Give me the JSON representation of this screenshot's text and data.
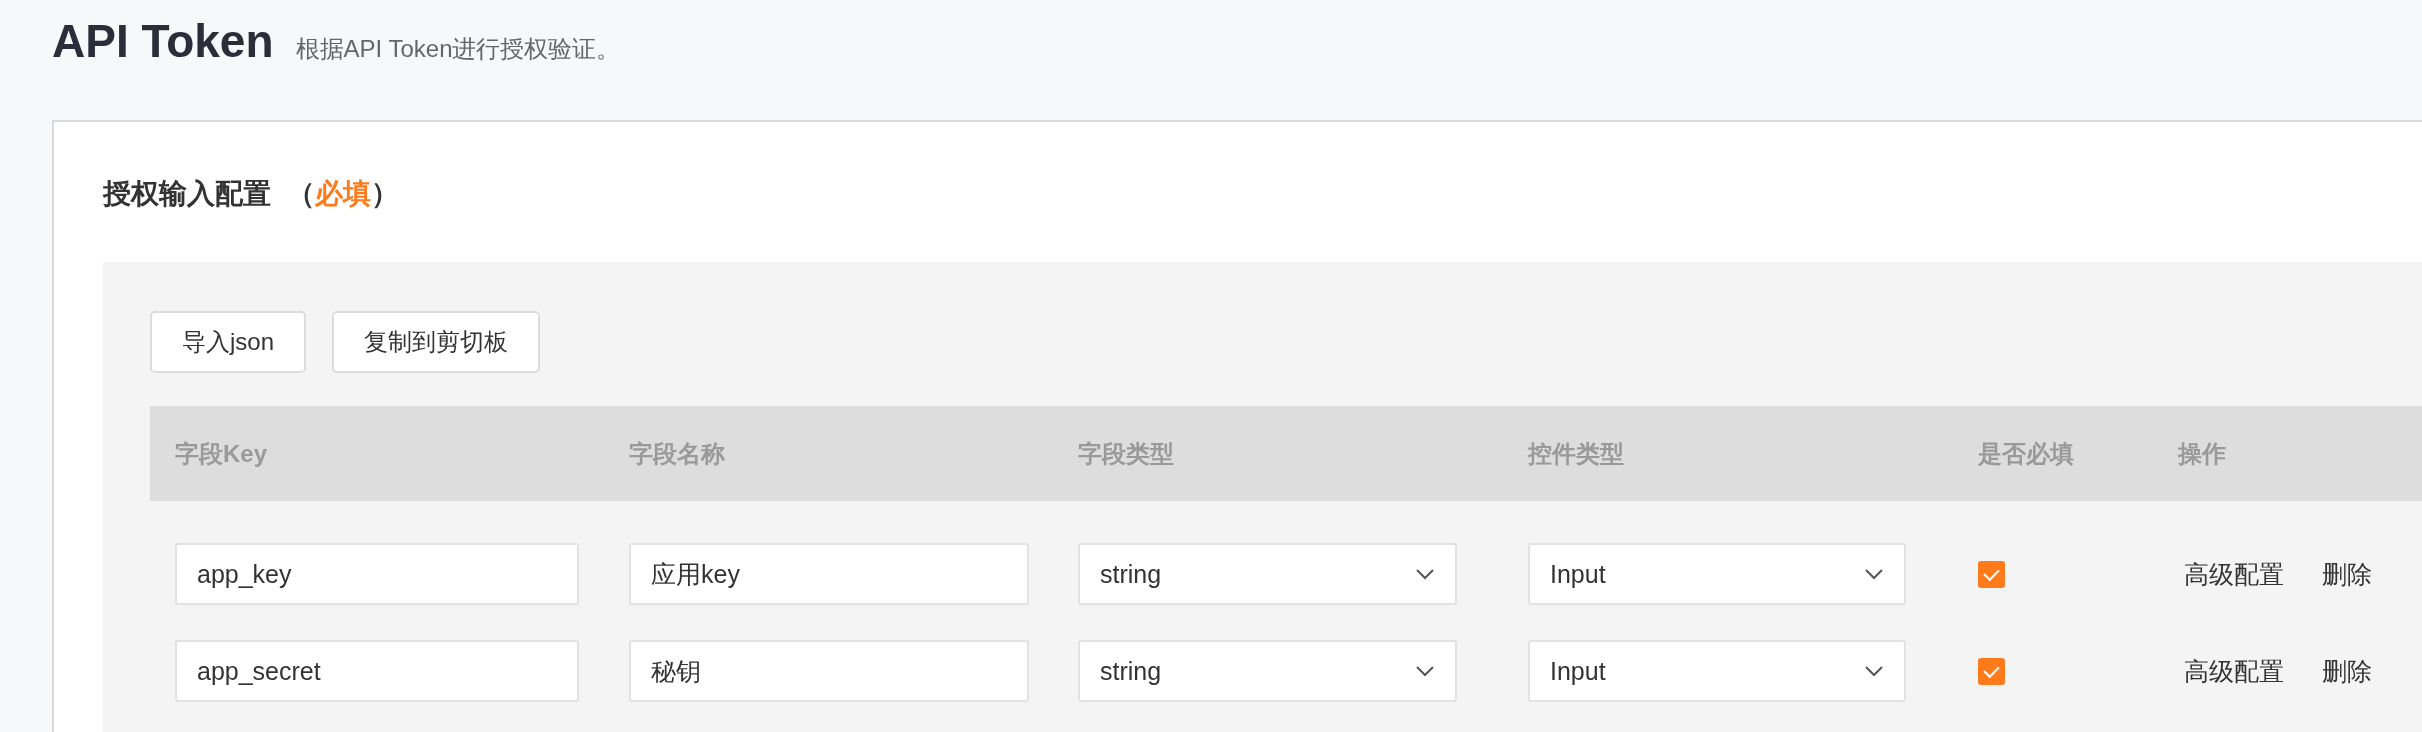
{
  "page": {
    "title": "API Token",
    "description": "根据API Token进行授权验证。"
  },
  "section": {
    "title": "授权输入配置",
    "required_note": {
      "open": "（",
      "text": "必填",
      "close": "）"
    }
  },
  "toolbar": {
    "buttons": [
      "导入json",
      "复制到剪切板"
    ]
  },
  "table": {
    "columns": [
      "字段Key",
      "字段名称",
      "字段类型",
      "控件类型",
      "是否必填",
      "操作"
    ],
    "rows": [
      {
        "key": "app_key",
        "name": "应用key",
        "type": "string",
        "control": "Input",
        "required": true,
        "actions": [
          "高级配置",
          "删除"
        ]
      },
      {
        "key": "app_secret",
        "name": "秘钥",
        "type": "string",
        "control": "Input",
        "required": true,
        "actions": [
          "高级配置",
          "删除"
        ]
      }
    ]
  }
}
